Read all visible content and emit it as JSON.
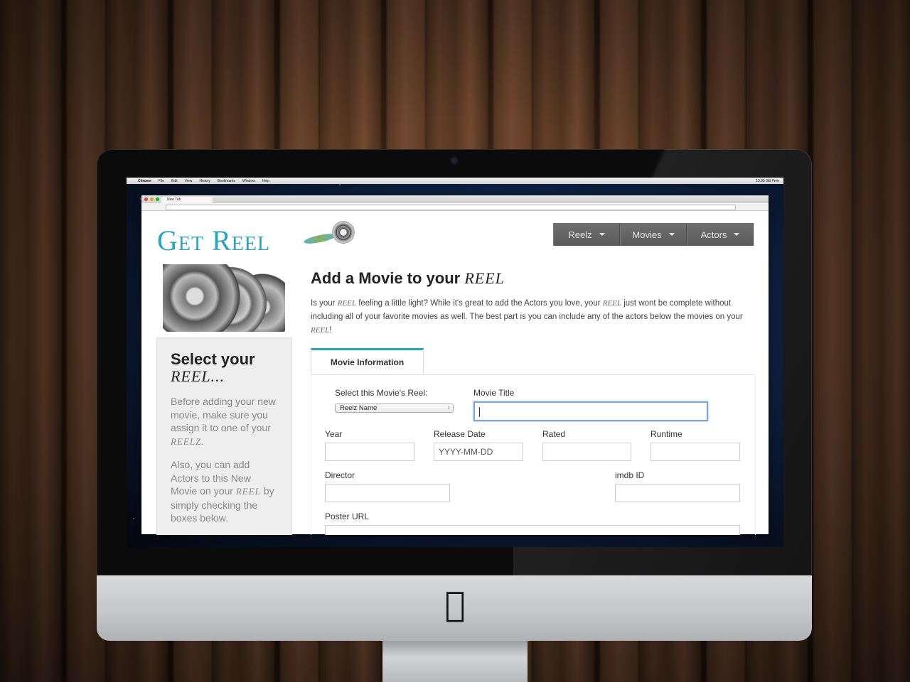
{
  "mac_menubar": {
    "app": "Chrome",
    "items": [
      "File",
      "Edit",
      "View",
      "History",
      "Bookmarks",
      "Window",
      "Help"
    ],
    "status": "13.89 GB Free"
  },
  "browser": {
    "tab_title": "New Tab"
  },
  "site": {
    "logo_text": "Get Reel",
    "nav": [
      {
        "label": "Reelz"
      },
      {
        "label": "Movies"
      },
      {
        "label": "Actors"
      }
    ]
  },
  "sidebar": {
    "heading_prefix": "Select your",
    "heading_reel": "REEL...",
    "p1_a": "Before adding your new movie, make sure you assign it to one of your ",
    "p1_reel": "REELZ.",
    "p2_a": "Also, you can add Actors to this New Movie on your ",
    "p2_reel": "REEL",
    "p2_b": " by simply checking the boxes below."
  },
  "main": {
    "title_prefix": "Add a Movie to your ",
    "title_reel": "REEL",
    "intro_a": "Is your ",
    "intro_reel1": "REEL",
    "intro_b": " feeling a little light? While it's great to add the Actors you love, your ",
    "intro_reel2": "REEL",
    "intro_c": " just wont be complete without including all of your favorite movies as well. The best part is you can include any of the actors below the movies on your ",
    "intro_reel3": "REEL",
    "intro_d": "!"
  },
  "form": {
    "tab_label": "Movie Information",
    "reel_select_label": "Select this Movie's Reel:",
    "reel_select_value": "Reelz Name",
    "movie_title_label": "Movie Title",
    "movie_title_value": "",
    "year_label": "Year",
    "release_date_label": "Release Date",
    "release_date_placeholder": "YYYY-MM-DD",
    "rated_label": "Rated",
    "runtime_label": "Runtime",
    "director_label": "Director",
    "imdb_label": "imdb ID",
    "poster_label": "Poster URL"
  }
}
